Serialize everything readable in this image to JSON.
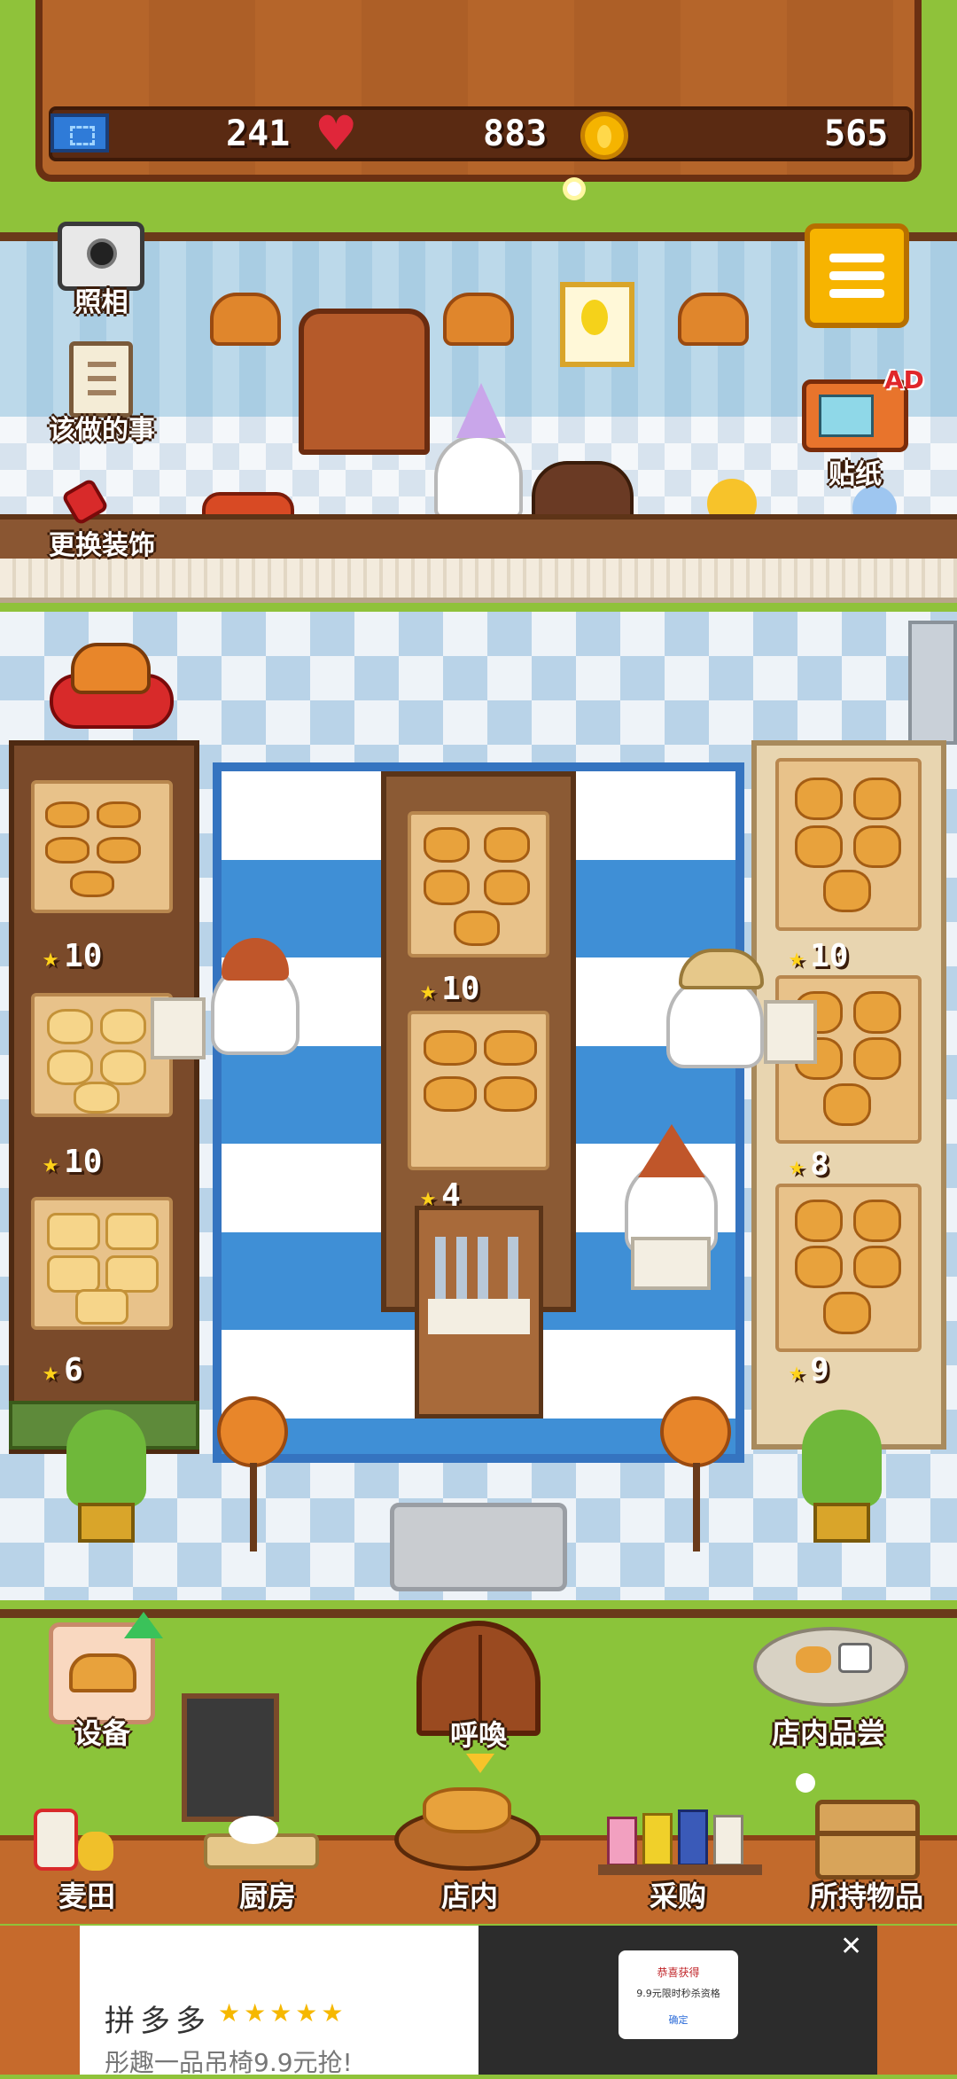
{
  "resources": {
    "tickets": "241",
    "hearts": "883",
    "coins": "565"
  },
  "wall_buttons": {
    "camera": "照相",
    "todo": "该做的事",
    "decor": "更换装饰",
    "stickers": "贴纸",
    "ad_badge": "AD"
  },
  "shelves": {
    "left": [
      {
        "stars": "10"
      },
      {
        "stars": "10"
      },
      {
        "stars": "6"
      }
    ],
    "middle": [
      {
        "stars": "10"
      },
      {
        "stars": "4"
      }
    ],
    "right": [
      {
        "stars": "10"
      },
      {
        "stars": "8"
      },
      {
        "stars": "9"
      }
    ]
  },
  "actions": {
    "equipment": "设备",
    "call": "呼喚",
    "tasting": "店内品尝"
  },
  "bottom_nav": {
    "items": [
      {
        "label": "麦田"
      },
      {
        "label": "厨房"
      },
      {
        "label": "店内"
      },
      {
        "label": "采购"
      },
      {
        "label": "所持物品"
      }
    ]
  },
  "ad": {
    "brand": "拼多多",
    "rating_stars": "★★★★★",
    "tagline": "彤趣一品吊椅9.9元抢!",
    "popup_title": "恭喜获得",
    "popup_text": "9.9元限时秒杀资格",
    "popup_button": "确定",
    "close": "✕"
  },
  "colors": {
    "grass": "#8bc43a",
    "wood": "#b5652a",
    "rug_blue": "#3f8fd6",
    "coin": "#f5b400",
    "heart": "#e0263a",
    "ticket": "#2f7bd8"
  }
}
